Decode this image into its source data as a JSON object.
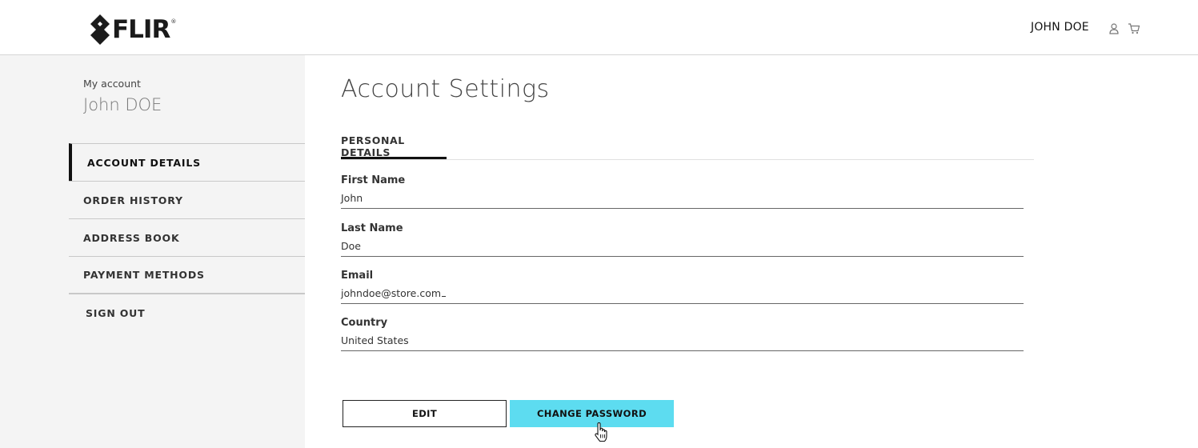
{
  "header": {
    "logo_text": "FLIR",
    "logo_reg": "®",
    "user_name": "JOHN DOE",
    "icons": [
      "user-icon",
      "cart-icon"
    ]
  },
  "sidebar": {
    "my_account_label": "My account",
    "user_name": "John DOE",
    "items": [
      {
        "label": "ACCOUNT DETAILS",
        "active": true
      },
      {
        "label": "ORDER HISTORY"
      },
      {
        "label": "ADDRESS BOOK"
      },
      {
        "label": "PAYMENT METHODS"
      },
      {
        "label": "SIGN OUT"
      }
    ]
  },
  "main": {
    "title": "Account Settings",
    "tabs": [
      {
        "label": "PERSONAL DETAILS",
        "active": true
      }
    ],
    "fields": [
      {
        "label": "First Name",
        "value": "John"
      },
      {
        "label": "Last Name",
        "value": "Doe"
      },
      {
        "label": "Email",
        "value": "johndoe@store.com"
      },
      {
        "label": "Country",
        "value": "United States"
      }
    ],
    "buttons": {
      "edit": "EDIT",
      "change_password": "CHANGE PASSWORD"
    }
  },
  "colors": {
    "accent": "#5ddcf0",
    "sidebar_bg": "#f4f4f4",
    "text": "#222222"
  }
}
